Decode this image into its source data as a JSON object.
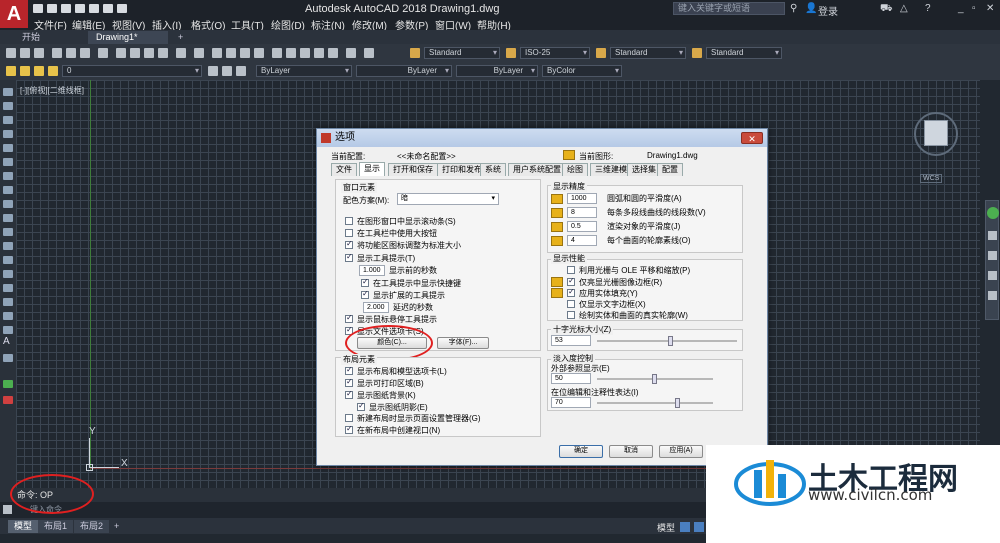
{
  "app": {
    "title": "Autodesk AutoCAD 2018    Drawing1.dwg",
    "search_placeholder": "键入关键字或短语",
    "login": "登录"
  },
  "menu": [
    "文件(F)",
    "编辑(E)",
    "视图(V)",
    "插入(I)",
    "格式(O)",
    "工具(T)",
    "绘图(D)",
    "标注(N)",
    "修改(M)",
    "参数(P)",
    "窗口(W)",
    "帮助(H)"
  ],
  "doc_tabs": {
    "start": "开始",
    "drawing": "Drawing1*",
    "add": "+"
  },
  "toolbar": {
    "text_style": "Standard",
    "dim_style": "ISO-25",
    "table_style": "Standard",
    "mleader_style": "Standard",
    "layer": "0",
    "color": "ByLayer",
    "linetype": "ByLayer",
    "lineweight": "ByLayer",
    "plotstyle": "ByColor"
  },
  "canvas": {
    "view_label": "[-][俯视][二维线框]",
    "ucs_x": "X",
    "ucs_y": "Y",
    "wcs": "WCS"
  },
  "command": {
    "history": "命令: OP",
    "placeholder": "键入命令"
  },
  "layout_tabs": [
    "模型",
    "布局1",
    "布局2",
    "+"
  ],
  "status_model": "模型",
  "dialog": {
    "title": "选项",
    "current_profile_label": "当前配置:",
    "current_profile_value": "<<未命名配置>>",
    "current_drawing_label": "当前图形:",
    "current_drawing_value": "Drawing1.dwg",
    "tabs": [
      "文件",
      "显示",
      "打开和保存",
      "打印和发布",
      "系统",
      "用户系统配置",
      "绘图",
      "三维建模",
      "选择集",
      "配置"
    ],
    "window_elements": {
      "title": "窗口元素",
      "color_scheme_label": "配色方案(M):",
      "color_scheme_value": "暗",
      "items": [
        {
          "label": "在图形窗口中显示滚动条(S)",
          "checked": false
        },
        {
          "label": "在工具栏中使用大按钮",
          "checked": false
        },
        {
          "label": "将功能区图标调整为标准大小",
          "checked": true
        },
        {
          "label": "显示工具提示(T)",
          "checked": true
        }
      ],
      "tooltip_delay_value": "1.000",
      "tooltip_delay_label": "显示前的秒数",
      "sub_items": [
        {
          "label": "在工具提示中显示快捷键",
          "checked": true
        },
        {
          "label": "显示扩展的工具提示",
          "checked": true
        }
      ],
      "ext_delay_value": "2.000",
      "ext_delay_label": "延迟的秒数",
      "more_items": [
        {
          "label": "显示鼠标悬停工具提示",
          "checked": true
        },
        {
          "label": "显示文件选项卡(S)",
          "checked": true
        }
      ],
      "color_button": "颜色(C)...",
      "font_button": "字体(F)..."
    },
    "layout_elements": {
      "title": "布局元素",
      "items": [
        {
          "label": "显示布局和模型选项卡(L)",
          "checked": true
        },
        {
          "label": "显示可打印区域(B)",
          "checked": true
        },
        {
          "label": "显示图纸背景(K)",
          "checked": true
        },
        {
          "label": "显示图纸阴影(E)",
          "checked": true
        },
        {
          "label": "新建布局时显示页面设置管理器(G)",
          "checked": false
        },
        {
          "label": "在新布局中创建视口(N)",
          "checked": true
        }
      ]
    },
    "display_resolution": {
      "title": "显示精度",
      "items": [
        {
          "value": "1000",
          "label": "圆弧和圆的平滑度(A)"
        },
        {
          "value": "8",
          "label": "每条多段线曲线的线段数(V)"
        },
        {
          "value": "0.5",
          "label": "渲染对象的平滑度(J)"
        },
        {
          "value": "4",
          "label": "每个曲面的轮廓素线(O)"
        }
      ]
    },
    "display_performance": {
      "title": "显示性能",
      "items": [
        {
          "label": "利用光栅与 OLE 平移和缩放(P)",
          "checked": false
        },
        {
          "label": "仅亮显光栅图像边框(R)",
          "checked": true
        },
        {
          "label": "应用实体填充(Y)",
          "checked": true
        },
        {
          "label": "仅显示文字边框(X)",
          "checked": false
        },
        {
          "label": "绘制实体和曲面的真实轮廓(W)",
          "checked": false
        }
      ]
    },
    "crosshair": {
      "title": "十字光标大小(Z)",
      "value": "53",
      "fraction": 0.53
    },
    "fade": {
      "title": "淡入度控制",
      "xref_label": "外部参照显示(E)",
      "xref_value": "50",
      "xref_fraction": 0.5,
      "inplace_label": "在位编辑和注释性表达(I)",
      "inplace_value": "70",
      "inplace_fraction": 0.7
    },
    "buttons": {
      "ok": "确定",
      "cancel": "取消",
      "apply": "应用(A)"
    }
  },
  "brand": {
    "name": "土木工程网",
    "url": "www.civilcn.com"
  }
}
